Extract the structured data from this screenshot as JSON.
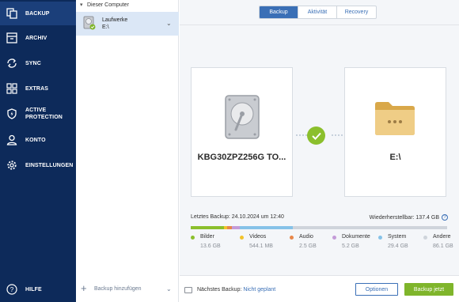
{
  "nav": {
    "items": [
      {
        "label": "BACKUP",
        "icon": "copy-icon",
        "active": true
      },
      {
        "label": "ARCHIV",
        "icon": "archive-box-icon"
      },
      {
        "label": "SYNC",
        "icon": "sync-icon"
      },
      {
        "label": "EXTRAS",
        "icon": "grid-icon"
      },
      {
        "label": "ACTIVE",
        "label2": "PROTECTION",
        "icon": "shield-icon"
      },
      {
        "label": "KONTO",
        "icon": "user-icon"
      },
      {
        "label": "EINSTELLUNGEN",
        "icon": "gear-icon"
      }
    ],
    "help": {
      "label": "HILFE",
      "icon": "question-circle-icon"
    }
  },
  "sources": {
    "group_title": "Dieser Computer",
    "selected": {
      "name": "Laufwerke",
      "sub": "E:\\"
    },
    "add_label": "Backup hinzufügen"
  },
  "tabs": [
    {
      "label": "Backup",
      "active": true
    },
    {
      "label": "Aktivität"
    },
    {
      "label": "Recovery"
    }
  ],
  "source_card": {
    "label": "KBG30ZPZ256G TO..."
  },
  "dest_card": {
    "label": "E:\\"
  },
  "status": {
    "last_backup": "Letztes Backup: 24.10.2024 um 12:40",
    "recoverable": "Wiederherstellbar: 137.4 GB"
  },
  "storage": {
    "categories": [
      {
        "name": "Bilder",
        "size": "13.6 GB",
        "color": "#8bbf2c",
        "fraction": 0.13
      },
      {
        "name": "Videos",
        "size": "544.1 MB",
        "color": "#f2c32c",
        "fraction": 0.013
      },
      {
        "name": "Audio",
        "size": "2.5 GB",
        "color": "#e8874a",
        "fraction": 0.018
      },
      {
        "name": "Dokumente",
        "size": "5.2 GB",
        "color": "#c49bd8",
        "fraction": 0.03
      },
      {
        "name": "System",
        "size": "29.4 GB",
        "color": "#86c2e8",
        "fraction": 0.207
      },
      {
        "name": "Andere",
        "size": "86.1 GB",
        "color": "#cfd4db",
        "fraction": 0.602
      }
    ]
  },
  "footer": {
    "next_prefix": "Nächstes Backup: ",
    "next_value": "Nicht geplant",
    "options_label": "Optionen",
    "backup_now_label": "Backup jetzt"
  }
}
